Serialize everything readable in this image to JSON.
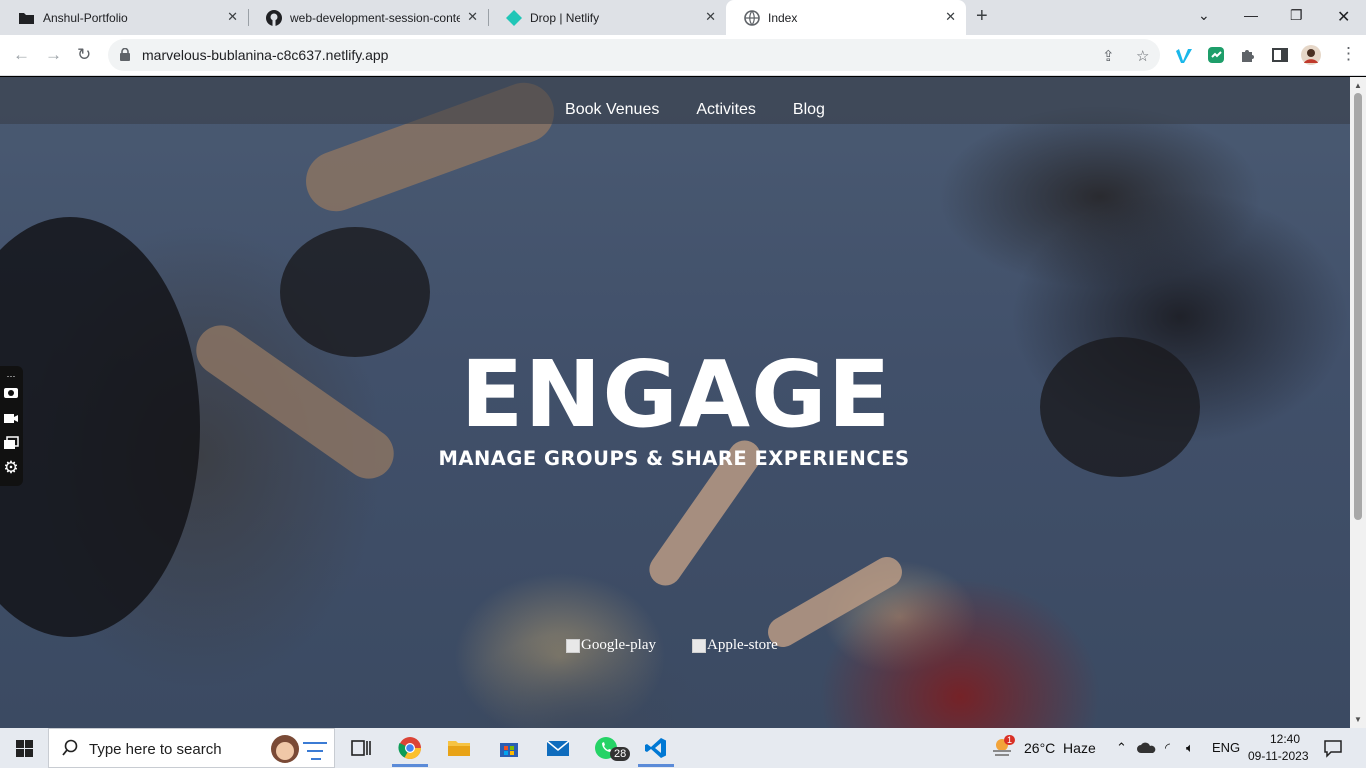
{
  "browser": {
    "tabs": [
      {
        "label": "Anshul-Portfolio",
        "icon": "folder-icon"
      },
      {
        "label": "web-development-session-conte",
        "icon": "github-icon"
      },
      {
        "label": "Drop | Netlify",
        "icon": "netlify-icon"
      },
      {
        "label": "Index",
        "icon": "globe-icon",
        "active": true
      }
    ],
    "url": "marvelous-bublanina-c8c637.netlify.app"
  },
  "page": {
    "nav": [
      "Book Venues",
      "Activites",
      "Blog"
    ],
    "hero_title": "ENGAGE",
    "hero_subtitle": "MANAGE GROUPS & SHARE EXPERIENCES",
    "store_alt": {
      "google": "Google-play",
      "apple": "Apple-store"
    }
  },
  "taskbar": {
    "search_placeholder": "Type here to search",
    "weather": "26°C  Haze",
    "weather_badge": "1",
    "language": "ENG",
    "time": "12:40",
    "date": "09-11-2023",
    "whatsapp_badge": "28"
  },
  "colors": {
    "accent_vimeo": "#1ab7ea",
    "netlify": "#20c6b7",
    "chrome_tab_bg": "#dee1e6"
  }
}
